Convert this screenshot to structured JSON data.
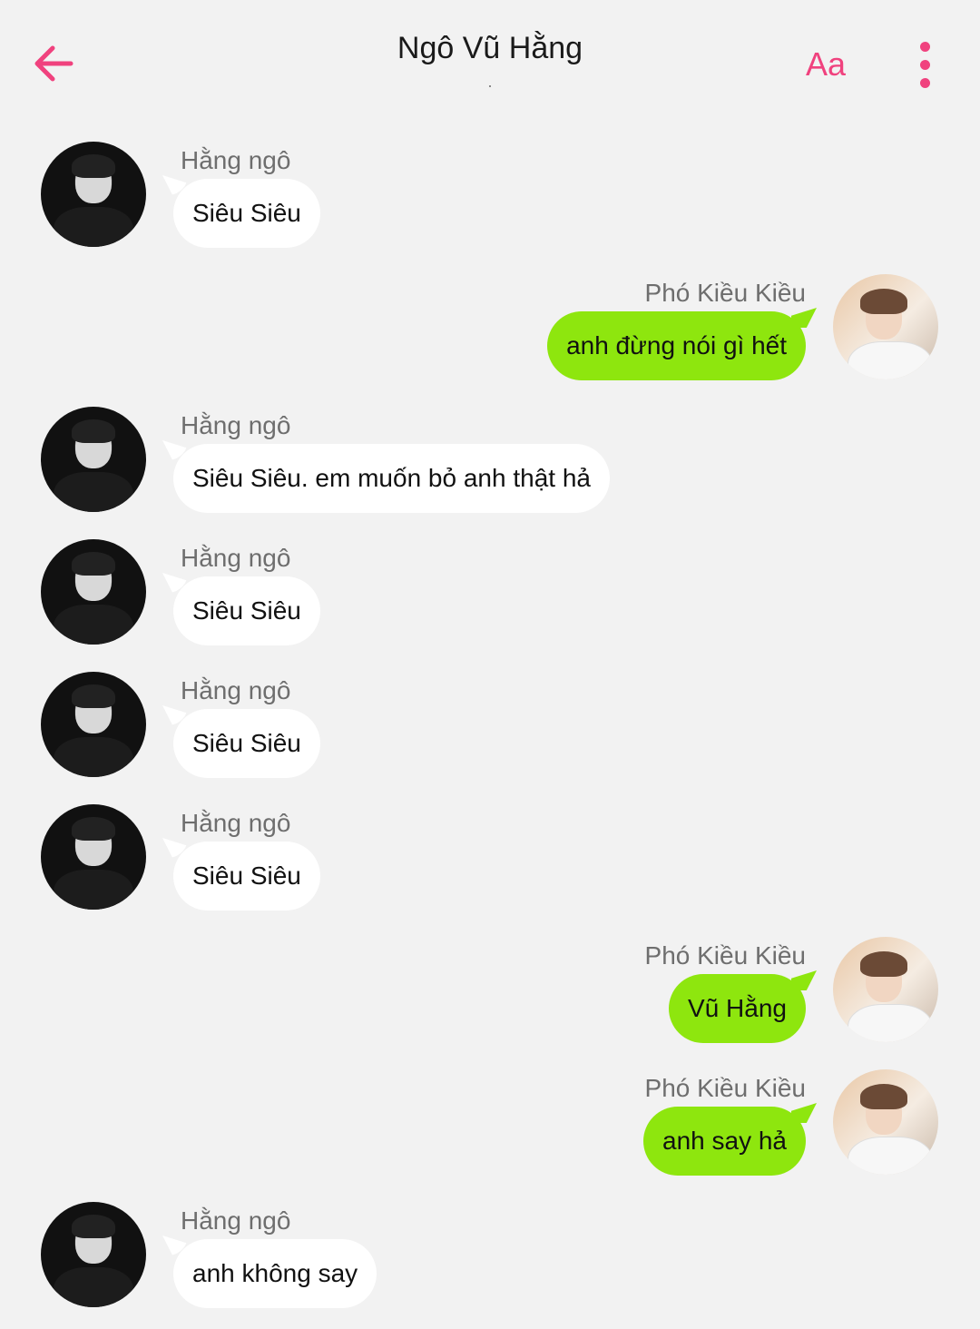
{
  "header": {
    "title": "Ngô Vũ Hằng",
    "subtitle": ".",
    "font_label": "Aa",
    "accent_color": "#f0427e"
  },
  "icons": {
    "back": "arrow-left-icon",
    "more": "vertical-dots-icon"
  },
  "messages": [
    {
      "side": "left",
      "sender": "Hằng ngô",
      "text": "Siêu Siêu"
    },
    {
      "side": "right",
      "sender": "Phó Kiều Kiều",
      "text": "anh đừng nói gì hết"
    },
    {
      "side": "left",
      "sender": "Hằng ngô",
      "text": "Siêu Siêu. em muốn bỏ anh thật hả"
    },
    {
      "side": "left",
      "sender": "Hằng ngô",
      "text": "Siêu Siêu"
    },
    {
      "side": "left",
      "sender": "Hằng ngô",
      "text": "Siêu Siêu"
    },
    {
      "side": "left",
      "sender": "Hằng ngô",
      "text": "Siêu Siêu"
    },
    {
      "side": "right",
      "sender": "Phó Kiều Kiều",
      "text": "Vũ Hằng"
    },
    {
      "side": "right",
      "sender": "Phó Kiều Kiều",
      "text": "anh say hả"
    },
    {
      "side": "left",
      "sender": "Hằng ngô",
      "text": "anh không say"
    }
  ],
  "colors": {
    "incoming_bubble": "#ffffff",
    "outgoing_bubble": "#8ee60e",
    "background": "#f2f2f2"
  }
}
